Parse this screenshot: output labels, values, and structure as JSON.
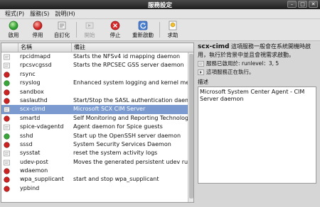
{
  "window": {
    "title": "服務設定"
  },
  "menu": [
    {
      "label": "程式(P)"
    },
    {
      "label": "服務(S)"
    },
    {
      "label": "說明(H)"
    }
  ],
  "toolbar": [
    {
      "label": "啟用",
      "icon": "enable-icon",
      "color": "#2e9e2e",
      "enabled": true
    },
    {
      "label": "停用",
      "icon": "disable-icon",
      "color": "#cc2222",
      "enabled": true
    },
    {
      "label": "自訂化",
      "icon": "customize-icon",
      "enabled": true
    },
    {
      "label": "開始",
      "icon": "start-icon",
      "enabled": false
    },
    {
      "label": "停止",
      "icon": "stop-icon",
      "color": "#cc2222",
      "enabled": true
    },
    {
      "label": "重新啟動",
      "icon": "restart-icon",
      "color": "#3a6fc4",
      "enabled": true
    },
    {
      "label": "求助",
      "icon": "help-icon",
      "enabled": true
    }
  ],
  "list": {
    "columns": [
      "名稱",
      "備註"
    ],
    "rows": [
      {
        "name": "rpcidmapd",
        "desc": "Starts the NFSv4 id mapping daemon",
        "status": "doc"
      },
      {
        "name": "rpcsvcgssd",
        "desc": "Starts the RPCSEC GSS server daemon",
        "status": "doc"
      },
      {
        "name": "rsync",
        "desc": "",
        "status": "red"
      },
      {
        "name": "rsyslog",
        "desc": "Enhanced system logging and kernel message",
        "status": "green"
      },
      {
        "name": "sandbox",
        "desc": "",
        "status": "red"
      },
      {
        "name": "saslauthd",
        "desc": "Start/Stop the SASL authentication daemon",
        "status": "red"
      },
      {
        "name": "scx-cimd",
        "desc": "Microsoft SCX CIM Server",
        "status": "doc",
        "selected": true
      },
      {
        "name": "smartd",
        "desc": "Self Monitoring and Reporting Technology (SMA",
        "status": "red"
      },
      {
        "name": "spice-vdagentd",
        "desc": "Agent daemon for Spice guests",
        "status": "doc"
      },
      {
        "name": "sshd",
        "desc": "Start up the OpenSSH server daemon",
        "status": "green"
      },
      {
        "name": "sssd",
        "desc": "System Security Services Daemon",
        "status": "red"
      },
      {
        "name": "sysstat",
        "desc": "reset the system activity logs",
        "status": "doc"
      },
      {
        "name": "udev-post",
        "desc": "Moves the generated persistent udev rules to /",
        "status": "doc"
      },
      {
        "name": "wdaemon",
        "desc": "",
        "status": "red"
      },
      {
        "name": "wpa_supplicant",
        "desc": "start and stop wpa_supplicant",
        "status": "red"
      },
      {
        "name": "ypbind",
        "desc": "",
        "status": "red"
      }
    ]
  },
  "detail": {
    "service_name": "scx-cimd",
    "summary": "這項服務一般會在系統開機時啟用，執行於背景中並且會視需求啟動。",
    "runlevel_text": "服務已啟用於: runlevel：3, 5",
    "running_text": "這項服務正在執行。",
    "description_label": "描述",
    "description": "Microsoft System Center Agent - CIM Server daemon"
  },
  "colors": {
    "selection": "#7b9bd0",
    "enabled_dot": "#3aa53a",
    "disabled_dot": "#cc2222"
  }
}
